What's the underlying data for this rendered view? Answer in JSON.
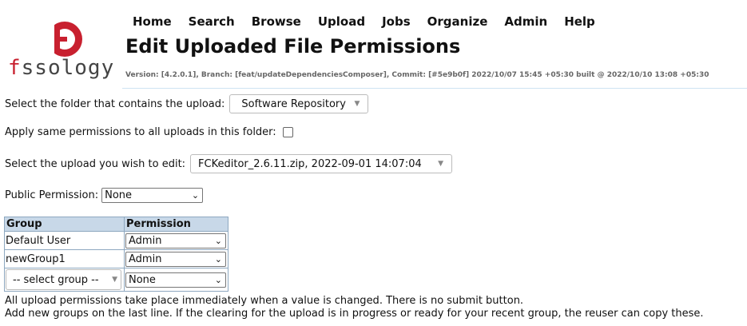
{
  "logo": {
    "text_prefix": "f",
    "text_rest": "ssology",
    "accent": "#c8202f"
  },
  "menu": [
    "Home",
    "Search",
    "Browse",
    "Upload",
    "Jobs",
    "Organize",
    "Admin",
    "Help"
  ],
  "page_title": "Edit Uploaded File Permissions",
  "version": "Version: [4.2.0.1], Branch: [feat/updateDependenciesComposer], Commit: [#5e9b0f] 2022/10/07 15:45 +05:30 built @ 2022/10/10 13:08 +05:30",
  "folder": {
    "label": "Select the folder that contains the upload:",
    "value": "Software Repository"
  },
  "apply_all": {
    "label": "Apply same permissions to all uploads in this folder:"
  },
  "upload": {
    "label": "Select the upload you wish to edit:",
    "value": "FCKeditor_2.6.11.zip, 2022-09-01 14:07:04"
  },
  "public_perm": {
    "label": "Public Permission:",
    "value": "None"
  },
  "table": {
    "headers": [
      "Group",
      "Permission"
    ],
    "rows": [
      {
        "group": "Default User",
        "permission": "Admin"
      },
      {
        "group": "newGroup1",
        "permission": "Admin"
      }
    ],
    "new_row": {
      "group_placeholder": "-- select group --",
      "permission": "None"
    }
  },
  "notes": [
    "All upload permissions take place immediately when a value is changed. There is no submit button.",
    "Add new groups on the last line. If the clearing for the upload is in progress or ready for your recent group, the reuser can copy these."
  ],
  "colors": {
    "header_bg": "#c8d8e8",
    "divider": "#cfe3f2",
    "brand_red": "#c8202f"
  }
}
